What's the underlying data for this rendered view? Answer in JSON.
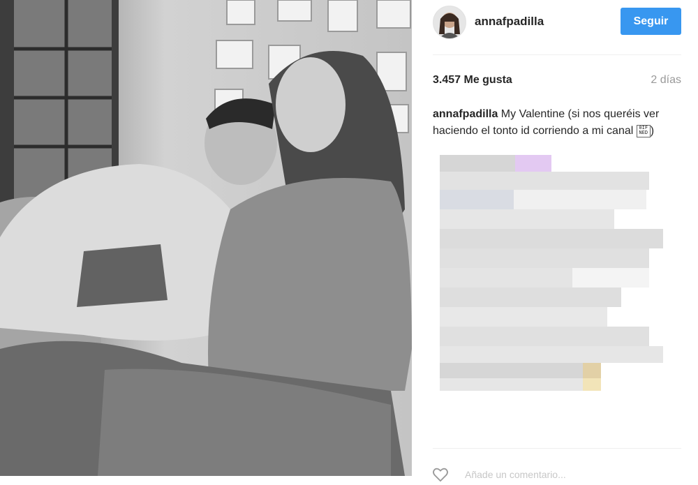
{
  "post": {
    "username": "annafpadilla",
    "follow_label": "Seguir",
    "likes": "3.457 Me gusta",
    "time_ago": "2 días",
    "caption_user": "annafpadilla",
    "caption_text": " My Valentine (si nos queréis ver haciendo el tonto id corriendo a mi canal ",
    "caption_emoji": "0IF NED",
    "caption_end": ")",
    "comment_placeholder": "Añade un comentario..."
  },
  "colors": {
    "accent": "#3897f0",
    "divider": "#efefef",
    "muted": "#999999"
  },
  "icons": {
    "like": "heart-outline-icon"
  }
}
